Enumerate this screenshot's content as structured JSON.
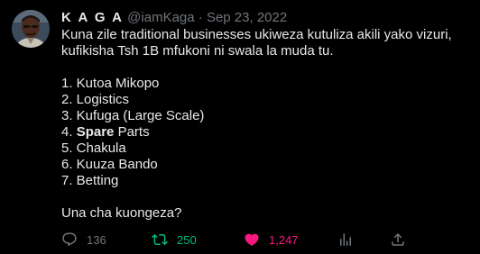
{
  "tweet": {
    "author_name": "K A G A",
    "handle": "@iamKaga",
    "separator": "·",
    "date": "Sep 23, 2022",
    "intro_line1": "Kuna zile traditional businesses ukiweza kutuliza akili yako vizuri,",
    "intro_line2": "kufikisha Tsh 1B mfukoni ni swala la muda tu.",
    "list": [
      "1. Kutoa Mikopo",
      "2. Logistics",
      "3. Kufuga (Large Scale)",
      "5. Chakula",
      "6. Kuuza Bando",
      "7. Betting"
    ],
    "item4_number": "4.",
    "item4_bold": "Spare",
    "item4_rest": "Parts",
    "closing": "Una cha kuongeza?"
  },
  "actions": {
    "reply_count": "136",
    "retweet_count": "250",
    "like_count": "1,247"
  },
  "colors": {
    "background": "#000000",
    "text": "#e7e9ea",
    "muted": "#71767b",
    "retweet_active": "#00ba7c",
    "like_active": "#f91880"
  },
  "icons": {
    "reply": "reply-icon",
    "retweet": "retweet-icon",
    "like": "heart-icon",
    "views": "analytics-icon",
    "share": "share-icon"
  }
}
